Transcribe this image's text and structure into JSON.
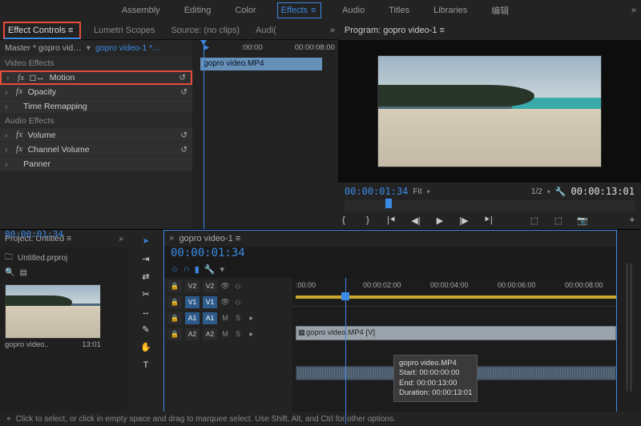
{
  "workspaces": {
    "items": [
      "Assembly",
      "Editing",
      "Color",
      "Effects",
      "Audio",
      "Titles",
      "Libraries",
      "编辑"
    ],
    "active": "Effects"
  },
  "leftPanel": {
    "tabs": {
      "effectControls": "Effect Controls",
      "lumetriScopes": "Lumetri Scopes",
      "source": "Source: (no clips)",
      "audio": "Audi("
    },
    "masterLabel": "Master * gopro vid…",
    "clipLabel": "gopro video-1 *…",
    "videoEffectsHdr": "Video Effects",
    "motion": "Motion",
    "opacity": "Opacity",
    "timeRemap": "Time Remapping",
    "audioEffectsHdr": "Audio Effects",
    "volume": "Volume",
    "channelVolume": "Channel Volume",
    "panner": "Panner",
    "miniRuler": {
      "t1": ":00:00",
      "t2": "00:00:08:00"
    },
    "miniClip": "gopro video.MP4"
  },
  "program": {
    "tab": "Program: gopro video-1",
    "timecode": "00:00:01:34",
    "fit": "Fit",
    "zoom": "1/2",
    "duration": "00:00:13:01"
  },
  "project": {
    "tab": "Project: Untitled",
    "file": "Untitled.prproj",
    "clipName": "gopro video..",
    "clipDur": "13:01"
  },
  "footerTimecode": "00:00:01:34",
  "timeline": {
    "tab": "gopro video-1",
    "timecode": "00:00:01:34",
    "ruler": {
      "t0": ":00:00",
      "t2": "00:00:02:00",
      "t4": "00:00:04:00",
      "t6": "00:00:06:00",
      "t8": "00:00:08:00"
    },
    "tracks": {
      "v2": "V2",
      "v1": "V1",
      "a1": "A1",
      "a2": "A2",
      "m": "M",
      "s": "S"
    },
    "videoClip": "gopro video.MP4 [V]",
    "tooltip": {
      "name": "gopro video.MP4",
      "start": "Start: 00:00:00:00",
      "end": "End: 00:00:13:00",
      "dur": "Duration: 00:00:13:01"
    }
  },
  "status": "Click to select, or click in empty space and drag to marquee select. Use Shift, Alt, and Ctrl for other options."
}
